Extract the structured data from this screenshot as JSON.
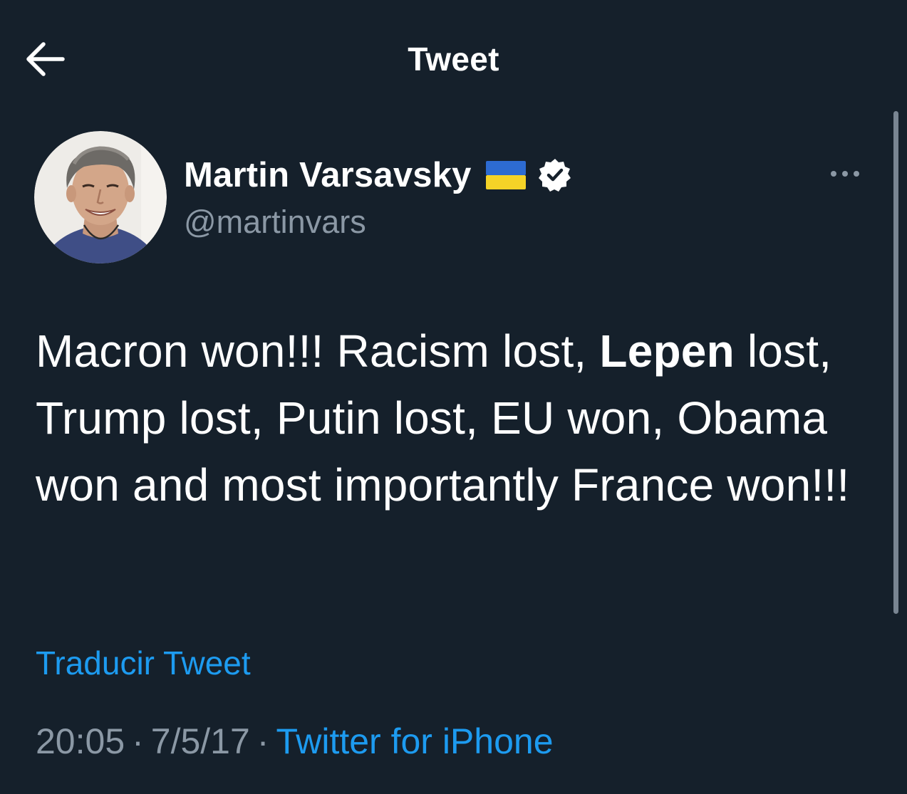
{
  "header": {
    "back_icon": "arrow-left-icon",
    "title": "Tweet"
  },
  "author": {
    "display_name": "Martin Varsavsky",
    "flag_icon": "ukraine-flag-icon",
    "verified_icon": "verified-badge-icon",
    "handle": "@martinvars",
    "more_icon": "more-horizontal-icon"
  },
  "tweet": {
    "text_part1": "Macron won!!! Racism lost, ",
    "text_bold": "Lepen",
    "text_part2": " lost, Trump lost, Putin lost,  EU won, Obama won and most importantly France won!!!"
  },
  "translate_label": "Traducir Tweet",
  "meta": {
    "time": "20:05",
    "separator": "·",
    "date": "7/5/17",
    "source": "Twitter for iPhone"
  },
  "colors": {
    "background": "#15202b",
    "link": "#1d9bf0",
    "secondary_text": "#8b98a5",
    "flag_blue": "#2d6bd1",
    "flag_yellow": "#f5d327"
  }
}
